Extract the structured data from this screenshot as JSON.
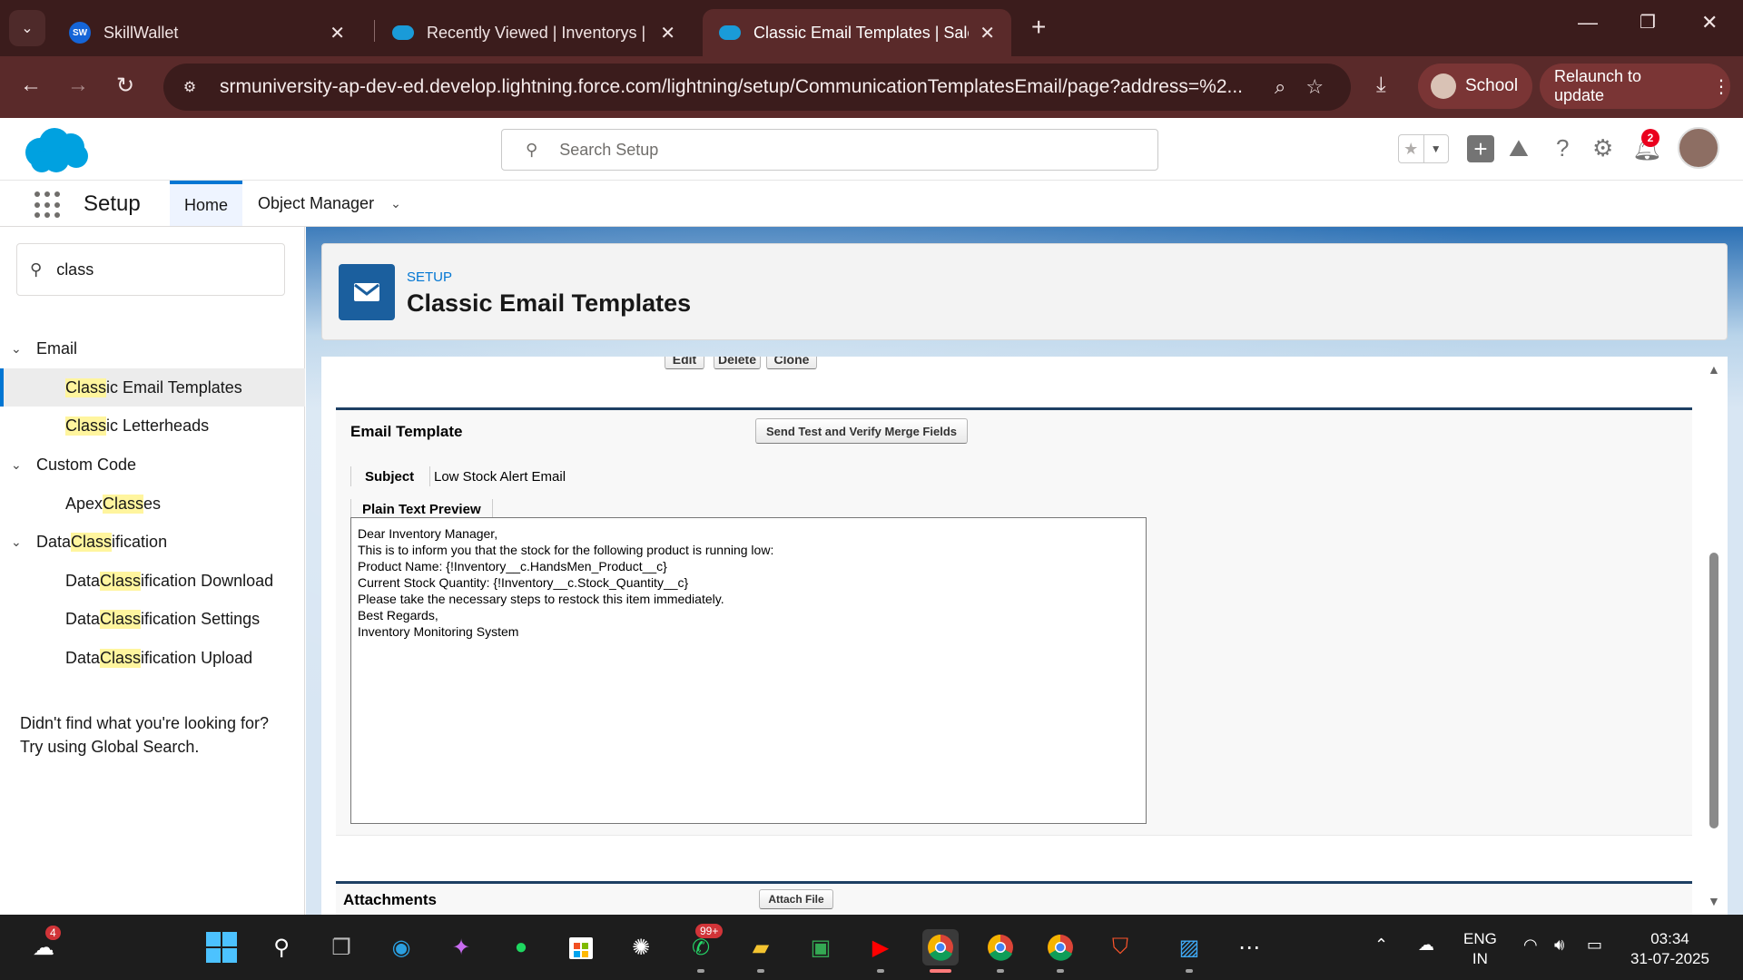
{
  "browser": {
    "tabs": [
      {
        "title": "SkillWallet",
        "favicon": "sw-icon"
      },
      {
        "title": "Recently Viewed | Inventorys | S",
        "favicon": "salesforce-icon"
      },
      {
        "title": "Classic Email Templates | Salesfo",
        "favicon": "salesforce-icon",
        "active": true
      }
    ],
    "url": "srmuniversity-ap-dev-ed.develop.lightning.force.com/lightning/setup/CommunicationTemplatesEmail/page?address=%2...",
    "profile_label": "School",
    "relaunch_label": "Relaunch to update"
  },
  "sf_header": {
    "search_placeholder": "Search Setup",
    "notification_count": "2"
  },
  "nav": {
    "app_name": "Setup",
    "tabs": [
      "Home",
      "Object Manager"
    ]
  },
  "sidebar": {
    "quick_find_value": "class",
    "groups": [
      {
        "label": "Email",
        "items": [
          {
            "before": "",
            "hl": "Class",
            "after": "ic Email Templates"
          },
          {
            "before": "",
            "hl": "Class",
            "after": "ic Letterheads"
          }
        ]
      },
      {
        "label": "Custom Code",
        "items": [
          {
            "before": "Apex ",
            "hl": "Class",
            "after": "es"
          }
        ]
      },
      {
        "label_before": "Data ",
        "label_hl": "Class",
        "label_after": "ification",
        "items": [
          {
            "before": "Data ",
            "hl": "Class",
            "after": "ification Download"
          },
          {
            "before": "Data ",
            "hl": "Class",
            "after": "ification Settings"
          },
          {
            "before": "Data ",
            "hl": "Class",
            "after": "ification Upload"
          }
        ]
      }
    ],
    "not_found_line1": "Didn't find what you're looking for?",
    "not_found_line2": "Try using Global Search."
  },
  "page_header": {
    "breadcrumb": "SETUP",
    "title": "Classic Email Templates"
  },
  "template": {
    "top_buttons": [
      "Edit",
      "Delete",
      "Clone"
    ],
    "section_title": "Email Template",
    "send_test_button": "Send Test and Verify Merge Fields",
    "subject_label": "Subject",
    "subject_value": "Low Stock Alert Email",
    "plain_text_label": "Plain Text Preview",
    "body_lines": [
      "Dear Inventory Manager,",
      "This is to inform you that the stock for the following product is running low:",
      "Product Name: {!Inventory__c.HandsMen_Product__c}",
      "Current Stock Quantity: {!Inventory__c.Stock_Quantity__c}",
      "Please take the necessary steps to restock this item immediately.",
      "Best Regards,",
      "Inventory Monitoring System"
    ],
    "attachments_title": "Attachments",
    "attach_file_button": "Attach File"
  },
  "taskbar": {
    "weather_badge": "4",
    "whatsapp_badge": "99+",
    "language_line1": "ENG",
    "language_line2": "IN",
    "time": "03:34",
    "date": "31-07-2025"
  },
  "colors": {
    "chrome_dark": "#3b1c1c",
    "chrome_mid": "#5a2a2a",
    "sf_brand": "#0176d3",
    "header_icon_bg": "#1b5f9e",
    "highlight": "#fff59e"
  }
}
